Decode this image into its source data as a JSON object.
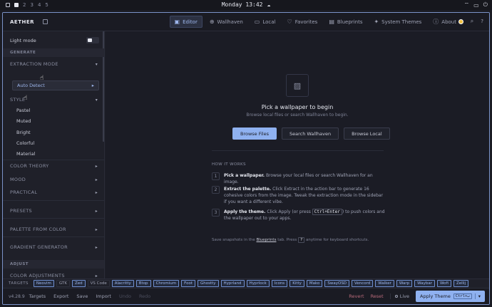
{
  "system_bar": {
    "workspaces": [
      "2",
      "3",
      "4",
      "5"
    ],
    "clock": "Monday 13:42"
  },
  "app": {
    "title": "AETHER",
    "tabs": [
      {
        "label": "Editor",
        "icon": "editor-icon",
        "active": true
      },
      {
        "label": "Wallhaven",
        "icon": "globe-icon",
        "active": false
      },
      {
        "label": "Local",
        "icon": "folder-icon",
        "active": false
      },
      {
        "label": "Favorites",
        "icon": "heart-icon",
        "active": false
      },
      {
        "label": "Blueprints",
        "icon": "blueprint-icon",
        "active": false
      },
      {
        "label": "System Themes",
        "icon": "sparkle-icon",
        "active": false
      },
      {
        "label": "About",
        "icon": "info-icon",
        "active": false
      }
    ]
  },
  "sidebar": {
    "light_mode_label": "Light mode",
    "generate_header": "GENERATE",
    "extraction_mode_label": "EXTRACTION MODE",
    "extraction_mode_value": "Auto Detect",
    "style_label": "STYLE",
    "styles": [
      "Pastel",
      "Muted",
      "Bright",
      "Colorful",
      "Material"
    ],
    "collapsibles_1": [
      "COLOR THEORY",
      "MOOD",
      "PRACTICAL"
    ],
    "presets": "PRESETS",
    "palette_from_color": "PALETTE FROM COLOR",
    "gradient_generator": "GRADIENT GENERATOR",
    "adjust_header": "ADJUST",
    "color_adjustments": "COLOR ADJUSTMENTS"
  },
  "main": {
    "title": "Pick a wallpaper to begin",
    "subtitle": "Browse local files or search Wallhaven to begin.",
    "buttons": {
      "browse_files": "Browse Files",
      "search_wallhaven": "Search Wallhaven",
      "browse_local": "Browse Local"
    },
    "how_it_works": "HOW IT WORKS",
    "steps": [
      {
        "num": "1",
        "bold": "Pick a wallpaper.",
        "text": " Browse your local files or search Wallhaven for an image."
      },
      {
        "num": "2",
        "bold": "Extract the palette.",
        "text": " Click Extract in the action bar to generate 16 cohesive colors from the image. Tweak the extraction mode in the sidebar if you want a different vibe."
      },
      {
        "num": "3",
        "bold": "Apply the theme.",
        "text_before": " Click Apply (or press ",
        "kbd": "Ctrl+Enter",
        "text_after": ") to push colors and the wallpaper out to your apps."
      }
    ],
    "note_before": "Save snapshots in the ",
    "note_link": "Blueprints",
    "note_mid": " tab. Press ",
    "note_kbd": "?",
    "note_after": " anytime for keyboard shortcuts."
  },
  "targets": {
    "label": "TARGETS",
    "items": [
      {
        "name": "Neovim",
        "on": true
      },
      {
        "name": "GTK",
        "on": false
      },
      {
        "name": "Zed",
        "on": true
      },
      {
        "name": "VS Code",
        "on": false
      },
      {
        "name": "Alacritty",
        "on": true
      },
      {
        "name": "Btop",
        "on": true
      },
      {
        "name": "Chromium",
        "on": true
      },
      {
        "name": "Foot",
        "on": true
      },
      {
        "name": "Ghostty",
        "on": true
      },
      {
        "name": "Hyprland",
        "on": true
      },
      {
        "name": "Hyprlock",
        "on": true
      },
      {
        "name": "Icons",
        "on": true
      },
      {
        "name": "Kitty",
        "on": true
      },
      {
        "name": "Mako",
        "on": true
      },
      {
        "name": "SwayOSD",
        "on": true
      },
      {
        "name": "Vencord",
        "on": true
      },
      {
        "name": "Walker",
        "on": true
      },
      {
        "name": "Warp",
        "on": true
      },
      {
        "name": "Waybar",
        "on": true
      },
      {
        "name": "Wofi",
        "on": true
      },
      {
        "name": "Zellij",
        "on": true
      }
    ]
  },
  "footer": {
    "version": "v4.28.9",
    "targets": "Targets",
    "export": "Export",
    "save": "Save",
    "import": "Import",
    "undo": "Undo",
    "redo": "Redo",
    "revert": "Revert",
    "reset": "Reset",
    "live": "Live",
    "apply": "Apply Theme",
    "apply_kbd": "Ctrl+↵"
  }
}
